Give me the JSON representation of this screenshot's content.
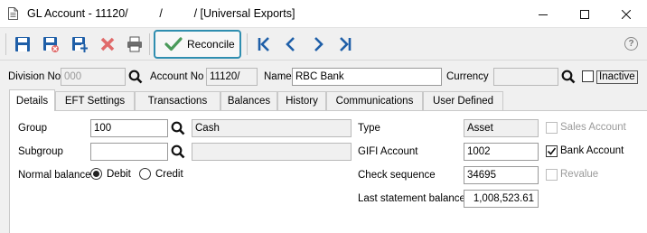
{
  "window": {
    "title": "GL Account - 11120/          /          / [Universal Exports]"
  },
  "toolbar": {
    "reconcile_label": "Reconcile",
    "icons": [
      "save-icon",
      "save-close-icon",
      "save-new-icon",
      "delete-icon",
      "print-icon",
      "reconcile-check-icon",
      "first-record-icon",
      "previous-record-icon",
      "next-record-icon",
      "last-record-icon",
      "help-icon"
    ],
    "help_label": "?"
  },
  "header": {
    "division_label": "Division No",
    "division_value": "000",
    "account_label": "Account No",
    "account_value": "11120/",
    "name_label": "Name",
    "name_value": "RBC Bank",
    "currency_label": "Currency",
    "currency_value": "",
    "inactive_label": "Inactive",
    "inactive_checked": false
  },
  "tabs": [
    {
      "label": "Details",
      "active": true
    },
    {
      "label": "EFT Settings"
    },
    {
      "label": "Transactions"
    },
    {
      "label": "Balances"
    },
    {
      "label": "History"
    },
    {
      "label": "Communications"
    },
    {
      "label": "User Defined"
    }
  ],
  "details": {
    "group_label": "Group",
    "group_value": "100",
    "group_desc": "Cash",
    "subgroup_label": "Subgroup",
    "subgroup_value": "",
    "subgroup_desc": "",
    "normal_balance_label": "Normal balance",
    "debit_label": "Debit",
    "credit_label": "Credit",
    "normal_balance": "Debit",
    "type_label": "Type",
    "type_value": "Asset",
    "gifi_label": "GIFI Account",
    "gifi_value": "1002",
    "check_seq_label": "Check sequence",
    "check_seq_value": "34695",
    "last_stmt_label": "Last statement balance",
    "last_stmt_value": "1,008,523.61",
    "sales_account_label": "Sales Account",
    "sales_account_checked": false,
    "bank_account_label": "Bank Account",
    "bank_account_checked": true,
    "revalue_label": "Revalue",
    "revalue_checked": false
  },
  "colors": {
    "accent": "#2f8eb0",
    "nav_blue": "#1f5fa8",
    "delete_red": "#e06a6a",
    "check_green": "#4a9a5a"
  }
}
